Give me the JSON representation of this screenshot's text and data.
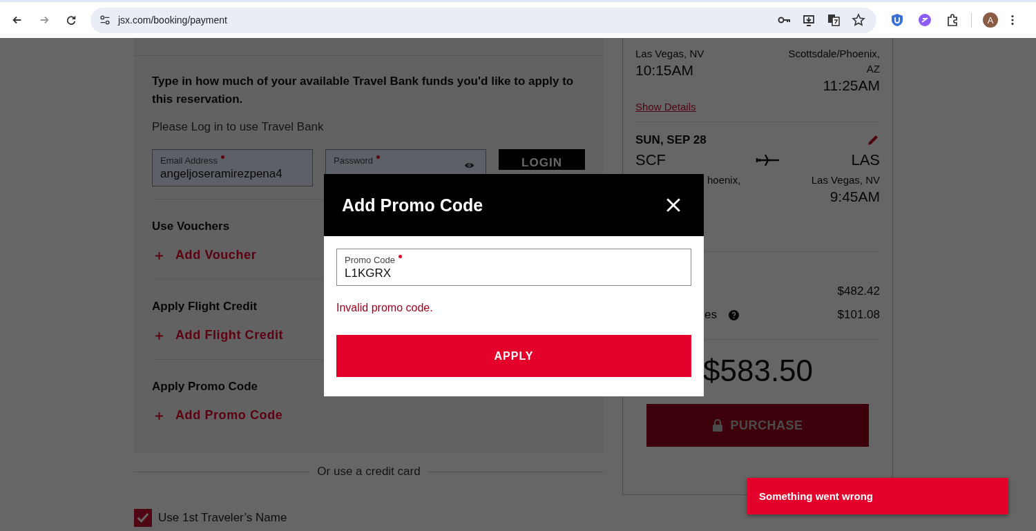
{
  "browser": {
    "url": "jsx.com/booking/payment",
    "profile_initial": "A"
  },
  "travel_bank": {
    "instructions": "Type in how much of your available Travel Bank funds you'd like to apply to this reservation.",
    "login_prompt": "Please Log in to use Travel Bank",
    "email": {
      "label": "Email Address",
      "value": "angeljoseramirezpena4"
    },
    "password": {
      "label": "Password"
    },
    "login_button": "LOGIN"
  },
  "sections": [
    {
      "title": "Use Vouchers",
      "action": "Add Voucher"
    },
    {
      "title": "Apply Flight Credit",
      "action": "Add Flight Credit"
    },
    {
      "title": "Apply Promo Code",
      "action": "Add Promo Code"
    }
  ],
  "credit_card_divider": "Or use a credit card",
  "name_checkbox": {
    "label": "Use 1st Traveler’s Name",
    "checked": true
  },
  "outbound": {
    "from_city": "Las Vegas, NV",
    "depart_time": "10:15AM",
    "to_city": "Scottsdale/Phoenix, AZ",
    "arrive_time": "11:25AM",
    "details_link": "Show Details"
  },
  "return": {
    "date": "SUN, SEP 28",
    "from_code": "SCF",
    "to_code": "LAS",
    "from_city": "hoenix,",
    "to_city": "Las Vegas, NV",
    "arrive_time": "9:45AM"
  },
  "fare": {
    "amount": "$482.42"
  },
  "taxes": {
    "label": "es",
    "amount": "$101.08"
  },
  "total": {
    "amount": "$583.50"
  },
  "purchase": {
    "label": "PURCHASE",
    "disabled": true
  },
  "modal": {
    "title": "Add Promo Code",
    "field_label": "Promo Code",
    "value": "L1KGRX",
    "error": "Invalid promo code.",
    "apply_button": "APPLY"
  },
  "toast": {
    "message": "Something went wrong"
  }
}
